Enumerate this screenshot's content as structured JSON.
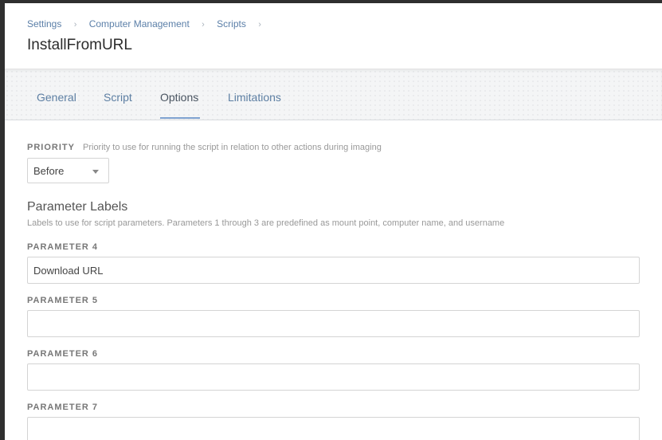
{
  "breadcrumb": {
    "items": [
      "Settings",
      "Computer Management",
      "Scripts"
    ],
    "separator": "›"
  },
  "page": {
    "title": "InstallFromURL"
  },
  "tabs": [
    {
      "label": "General",
      "active": false
    },
    {
      "label": "Script",
      "active": false
    },
    {
      "label": "Options",
      "active": true
    },
    {
      "label": "Limitations",
      "active": false
    }
  ],
  "priority": {
    "label": "PRIORITY",
    "description": "Priority to use for running the script in relation to other actions during imaging",
    "selected": "Before"
  },
  "parameter_labels": {
    "title": "Parameter Labels",
    "description": "Labels to use for script parameters. Parameters 1 through 3 are predefined as mount point, computer name, and username",
    "fields": [
      {
        "label": "PARAMETER 4",
        "value": "Download URL"
      },
      {
        "label": "PARAMETER 5",
        "value": ""
      },
      {
        "label": "PARAMETER 6",
        "value": ""
      },
      {
        "label": "PARAMETER 7",
        "value": ""
      }
    ]
  },
  "colors": {
    "link": "#5b7fa8",
    "active_tab_underline": "#7fa2d0",
    "background_frame": "#2f2f2f"
  }
}
